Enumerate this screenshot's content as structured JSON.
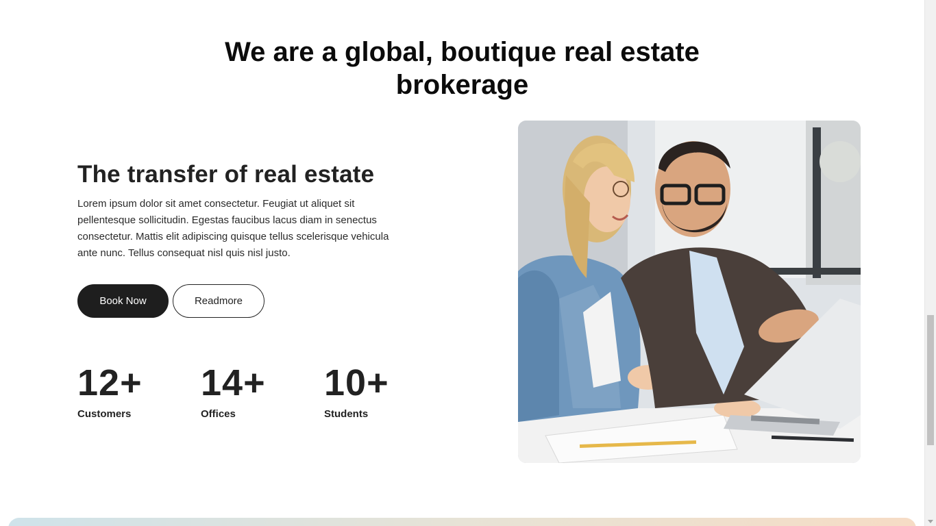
{
  "hero": {
    "heading_line1": "We are a global, boutique real estate",
    "heading_line2": "brokerage"
  },
  "about": {
    "title": "The transfer of real estate",
    "description": "Lorem ipsum dolor sit amet consectetur. Feugiat ut aliquet sit pellentesque sollicitudin. Egestas faucibus lacus diam in senectus consectetur. Mattis elit adipiscing quisque tellus scelerisque vehicula ante nunc. Tellus consequat nisl quis nisl justo.",
    "primary_button": "Book Now",
    "secondary_button": "Readmore"
  },
  "stats": [
    {
      "value": "12+",
      "label": "Customers"
    },
    {
      "value": "14+",
      "label": "Offices"
    },
    {
      "value": "10+",
      "label": "Students"
    }
  ],
  "photo": {
    "icon": "office-meeting-photo"
  },
  "colors": {
    "primary_button_bg": "#1e1e1e",
    "text_dark": "#222222",
    "band_gradient_start": "#cfe3ea",
    "band_gradient_end": "#f6dcc5"
  }
}
